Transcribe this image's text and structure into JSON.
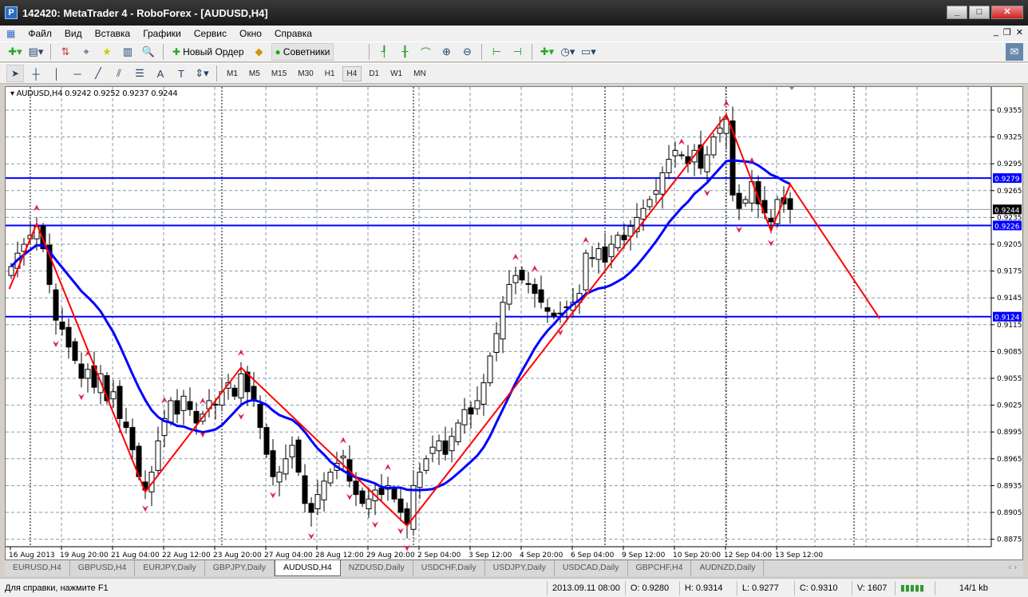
{
  "window": {
    "title": "142420: MetaTrader 4 - RoboForex - [AUDUSD,H4]",
    "minimize": "_",
    "maximize": "□",
    "close": "✕"
  },
  "menu": [
    "Файл",
    "Вид",
    "Вставка",
    "Графики",
    "Сервис",
    "Окно",
    "Справка"
  ],
  "toolbar": {
    "new_order": "Новый Ордер",
    "experts": "Советники"
  },
  "timeframes": [
    "M1",
    "M5",
    "M15",
    "M30",
    "H1",
    "H4",
    "D1",
    "W1",
    "MN"
  ],
  "active_timeframe": "H4",
  "chart_legend": "AUDUSD,H4  0.9242 0.9252 0.9237 0.9244",
  "chart_data": {
    "type": "candlestick",
    "symbol": "AUDUSD",
    "timeframe": "H4",
    "ylim": [
      0.886,
      0.9375
    ],
    "y_ticks": [
      "0.9355",
      "0.9325",
      "0.9295",
      "0.9265",
      "0.9235",
      "0.9205",
      "0.9175",
      "0.9145",
      "0.9115",
      "0.9085",
      "0.9055",
      "0.9025",
      "0.8995",
      "0.8965",
      "0.8935",
      "0.8905",
      "0.8875"
    ],
    "x_labels": [
      {
        "bar": 0,
        "label": "16 Aug 2013"
      },
      {
        "bar": 8,
        "label": "19 Aug 20:00"
      },
      {
        "bar": 16,
        "label": "21 Aug 04:00"
      },
      {
        "bar": 24,
        "label": "22 Aug 12:00"
      },
      {
        "bar": 32,
        "label": "23 Aug 20:00"
      },
      {
        "bar": 40,
        "label": "27 Aug 04:00"
      },
      {
        "bar": 48,
        "label": "28 Aug 12:00"
      },
      {
        "bar": 56,
        "label": "29 Aug 20:00"
      },
      {
        "bar": 64,
        "label": "2 Sep 04:00"
      },
      {
        "bar": 72,
        "label": "3 Sep 12:00"
      },
      {
        "bar": 80,
        "label": "4 Sep 20:00"
      },
      {
        "bar": 88,
        "label": "6 Sep 04:00"
      },
      {
        "bar": 96,
        "label": "9 Sep 12:00"
      },
      {
        "bar": 104,
        "label": "10 Sep 20:00"
      },
      {
        "bar": 112,
        "label": "12 Sep 04:00"
      },
      {
        "bar": 120,
        "label": "13 Sep 12:00"
      }
    ],
    "closes": [
      0.918,
      0.9195,
      0.9205,
      0.9215,
      0.9225,
      0.92,
      0.916,
      0.912,
      0.911,
      0.909,
      0.9075,
      0.9055,
      0.9065,
      0.9045,
      0.906,
      0.903,
      0.904,
      0.901,
      0.9,
      0.8975,
      0.8945,
      0.893,
      0.895,
      0.8985,
      0.901,
      0.903,
      0.9015,
      0.9035,
      0.902,
      0.9005,
      0.9015,
      0.903,
      0.9025,
      0.904,
      0.905,
      0.9035,
      0.906,
      0.904,
      0.903,
      0.9,
      0.897,
      0.8945,
      0.895,
      0.8965,
      0.898,
      0.895,
      0.8915,
      0.8905,
      0.8925,
      0.894,
      0.895,
      0.896,
      0.8968,
      0.894,
      0.8925,
      0.8915,
      0.892,
      0.893,
      0.8925,
      0.8935,
      0.892,
      0.8905,
      0.8892,
      0.8935,
      0.895,
      0.8965,
      0.8978,
      0.8985,
      0.897,
      0.899,
      0.9005,
      0.902,
      0.9015,
      0.903,
      0.905,
      0.908,
      0.9105,
      0.914,
      0.916,
      0.917,
      0.9165,
      0.916,
      0.915,
      0.914,
      0.913,
      0.9125,
      0.9128,
      0.9135,
      0.914,
      0.915,
      0.9195,
      0.919,
      0.92,
      0.9185,
      0.9205,
      0.9215,
      0.921,
      0.9225,
      0.9235,
      0.9245,
      0.9255,
      0.9265,
      0.9285,
      0.93,
      0.931,
      0.9305,
      0.9295,
      0.931,
      0.929,
      0.9305,
      0.9325,
      0.9335,
      0.9345,
      0.926,
      0.9245,
      0.9255,
      0.9275,
      0.925,
      0.924,
      0.923,
      0.9255,
      0.925,
      0.9244
    ],
    "ma_period": 14,
    "zigzag": [
      [
        -0.3,
        0.9155
      ],
      [
        4,
        0.9228
      ],
      [
        21,
        0.8928
      ],
      [
        36,
        0.9067
      ],
      [
        62,
        0.889
      ],
      [
        112,
        0.935
      ],
      [
        119,
        0.922
      ],
      [
        122,
        0.9272
      ],
      [
        136,
        0.9122
      ]
    ],
    "fractals_up": [
      4,
      12,
      24,
      30,
      36,
      52,
      59,
      79,
      82,
      90,
      105,
      112,
      116
    ],
    "fractals_down": [
      7,
      11,
      21,
      30,
      36,
      41,
      47,
      53,
      57,
      61,
      62,
      86,
      109,
      114,
      119
    ],
    "hlines": [
      {
        "price": "0.9279",
        "color": "#0000ff"
      },
      {
        "price": "0.9226",
        "color": "#0000ff"
      },
      {
        "price": "0.9124",
        "color": "#0000ff"
      }
    ],
    "current_price": "0.9244",
    "period_separators": [
      3,
      33,
      63,
      93,
      112,
      132
    ]
  },
  "tabs": [
    "EURUSD,H4",
    "GBPUSD,H4",
    "EURJPY,Daily",
    "GBPJPY,Daily",
    "AUDUSD,H4",
    "NZDUSD,Daily",
    "USDCHF,Daily",
    "USDJPY,Daily",
    "USDCAD,Daily",
    "GBPCHF,H4",
    "AUDNZD,Daily"
  ],
  "active_tab": "AUDUSD,H4",
  "status": {
    "help": "Для справки, нажмите F1",
    "time": "2013.09.11 08:00",
    "open": "O: 0.9280",
    "high": "H: 0.9314",
    "low": "L: 0.9277",
    "close": "C: 0.9310",
    "volume": "V: 1607",
    "traffic": "14/1 kb"
  }
}
